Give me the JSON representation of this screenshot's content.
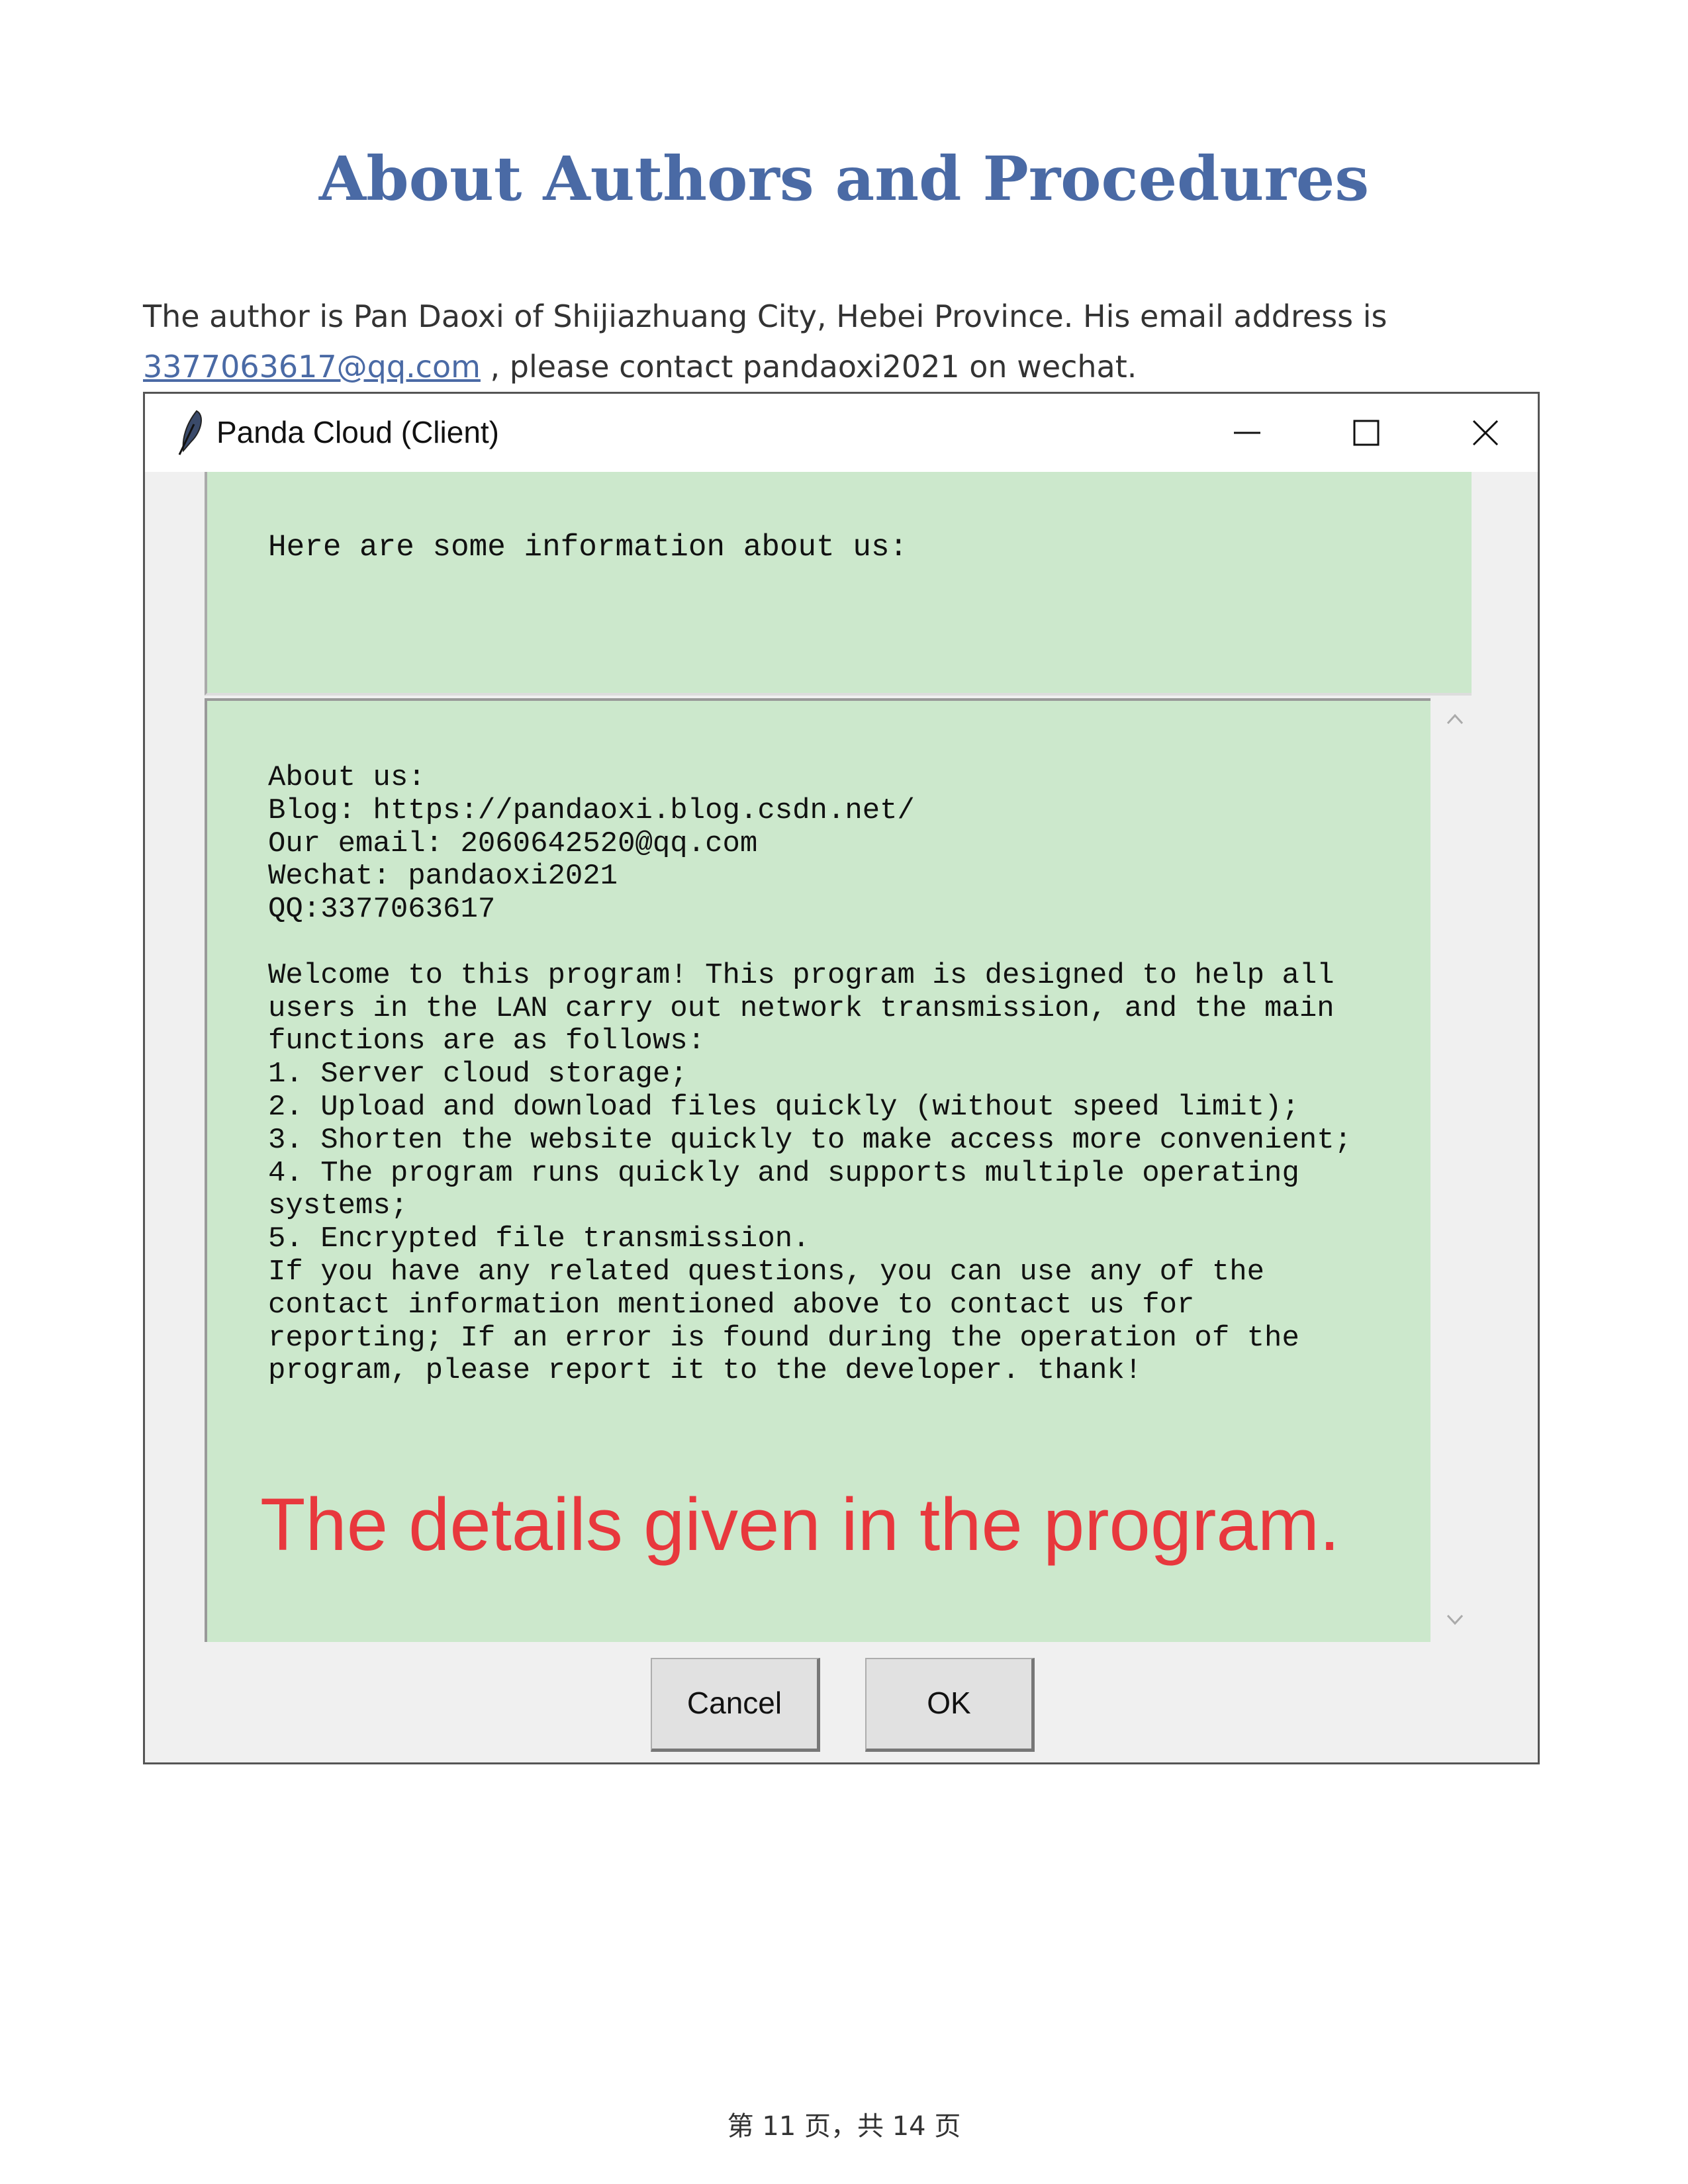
{
  "document": {
    "title": "About Authors and Procedures",
    "intro_text": "The author is Pan Daoxi of Shijiazhuang City, Hebei Province. His email address is ",
    "intro_link": "3377063617@qq.com",
    "intro_suffix": " , please contact pandaoxi2021 on wechat.",
    "footer": "第 11 页，共 14 页"
  },
  "window": {
    "title": "Panda Cloud (Client)",
    "header_text": "Here are some information about us:",
    "body_text": "About us:\nBlog: https://pandaoxi.blog.csdn.net/\nOur email: 2060642520@qq.com\nWechat: pandaoxi2021\nQQ:3377063617\n\nWelcome to this program! This program is designed to help all\nusers in the LAN carry out network transmission, and the main\nfunctions are as follows:\n1. Server cloud storage;\n2. Upload and download files quickly (without speed limit);\n3. Shorten the website quickly to make access more convenient;\n4. The program runs quickly and supports multiple operating\nsystems;\n5. Encrypted file transmission.\nIf you have any related questions, you can use any of the\ncontact information mentioned above to contact us for\nreporting; If an error is found during the operation of the\nprogram, please report it to the developer. thank!",
    "annotation": "The details given in the program.",
    "cancel_label": "Cancel",
    "ok_label": "OK"
  },
  "colors": {
    "title": "#4a6aa5",
    "panel": "#cce8cc",
    "annotation": "#e8383d"
  },
  "icons": [
    "feather-icon",
    "minimize-icon",
    "maximize-icon",
    "close-icon",
    "chevron-up-icon",
    "chevron-down-icon"
  ]
}
